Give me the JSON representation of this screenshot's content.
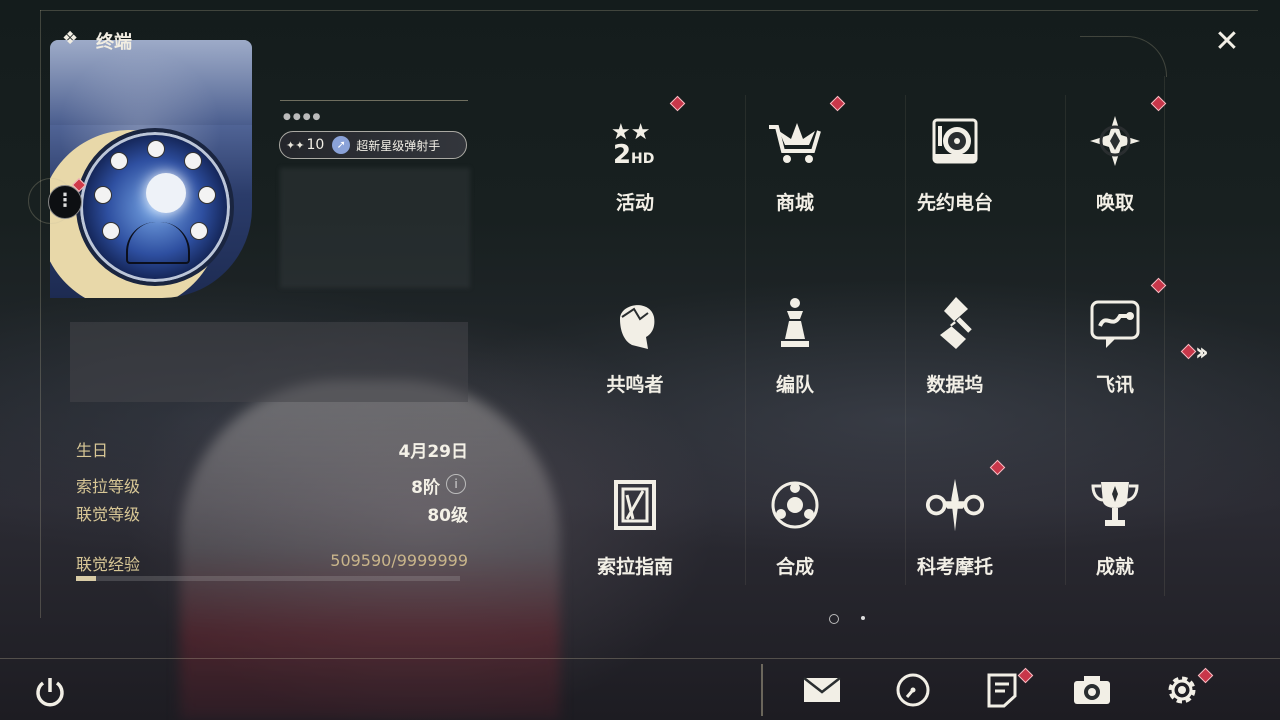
{
  "header": {
    "title": "终端"
  },
  "profile": {
    "level_prefix": "✦✦",
    "level": "10",
    "badge_title": "超新星级弹射手",
    "badge_icon": "rocket-icon",
    "more_icon": "more-vertical-icon"
  },
  "stats": {
    "birthday_label": "生日",
    "birthday_value": "4月29日",
    "sora_level_label": "索拉等级",
    "sora_level_value": "8阶",
    "union_level_label": "联觉等级",
    "union_level_value": "80级",
    "union_exp_label": "联觉经验",
    "union_exp_value": "509590/9999999",
    "union_exp_progress": 0.051
  },
  "menu": [
    {
      "label": "活动",
      "icon": "event-2nd-anniversary-icon",
      "badge": true
    },
    {
      "label": "商城",
      "icon": "shop-cart-icon",
      "badge": true
    },
    {
      "label": "先约电台",
      "icon": "radio-icon",
      "badge": false
    },
    {
      "label": "唤取",
      "icon": "convene-compass-icon",
      "badge": true
    },
    {
      "label": "共鸣者",
      "icon": "resonator-portrait-icon",
      "badge": false
    },
    {
      "label": "编队",
      "icon": "team-chess-icon",
      "badge": false
    },
    {
      "label": "数据坞",
      "icon": "data-bank-icon",
      "badge": false
    },
    {
      "label": "飞讯",
      "icon": "messenger-icon",
      "badge": true
    },
    {
      "label": "索拉指南",
      "icon": "guidebook-icon",
      "badge": false
    },
    {
      "label": "合成",
      "icon": "synthesis-icon",
      "badge": false
    },
    {
      "label": "科考摩托",
      "icon": "motorbike-icon",
      "badge": true
    },
    {
      "label": "成就",
      "icon": "trophy-icon",
      "badge": false
    }
  ],
  "pager": {
    "current": 1,
    "total": 2
  },
  "bottom_bar": [
    {
      "name": "mail",
      "icon": "mail-icon",
      "badge": false
    },
    {
      "name": "clock",
      "icon": "clock-icon",
      "badge": false
    },
    {
      "name": "notes",
      "icon": "notes-icon",
      "badge": true
    },
    {
      "name": "camera",
      "icon": "camera-icon",
      "badge": false
    },
    {
      "name": "settings",
      "icon": "gear-icon",
      "badge": true
    }
  ],
  "colors": {
    "accent_red": "#c8374a",
    "label_gold": "#d8c796",
    "text_light": "#f2efe6"
  }
}
